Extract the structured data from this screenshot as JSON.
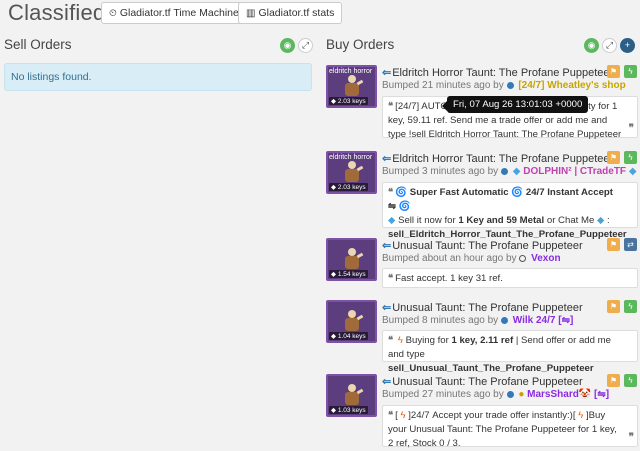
{
  "header": {
    "title": "Classifieds",
    "time_machine_label": "Gladiator.tf Time Machine",
    "stats_label": "Gladiator.tf stats"
  },
  "sell": {
    "title": "Sell Orders",
    "empty": "No listings found."
  },
  "buy": {
    "title": "Buy Orders",
    "listings": [
      {
        "thumb_name": "eldritch horror",
        "price": "2.03 keys",
        "title": "Eldritch Horror Taunt: The Profane Puppeteer",
        "bumped": "Bumped 21 minutes ago by",
        "user": "[24/7] Wheatley's shop",
        "user_color": "#c9a400",
        "msg_a": "[24/7] AUTO",
        "msg_b": "ng this beauty for 1 key, 59.11 ref. Send me a trade offer or add me and type !sell Eldritch Horror Taunt: The Profane Puppeteer",
        "action2": "lightning"
      },
      {
        "thumb_name": "eldritch horror",
        "price": "2.03 keys",
        "title": "Eldritch Horror Taunt: The Profane Puppeteer",
        "bumped": "Bumped 3 minutes ago by",
        "user": "DOLPHIN² | CTradeTF",
        "user_color": "#c040b0",
        "msg_a": "Super Fast Automatic",
        "msg_b": "24/7 Instant Accept ⇋",
        "msg_c": "Sell it now for",
        "msg_d": "1 Key and 59 Metal",
        "msg_e": "or Chat Me",
        "msg_f": "sell_Eldritch_Horror_Taunt_The_Profane_Puppeteer",
        "action2": "lightning"
      },
      {
        "price": "1.54 keys",
        "title": "Unusual Taunt: The Profane Puppeteer",
        "bumped": "Bumped about an hour ago by",
        "user": "Vexon",
        "user_color": "#8a2be2",
        "msg_a": "Fast accept. 1 key 31 ref.",
        "action2": "swap"
      },
      {
        "price": "1.04 keys",
        "title": "Unusual Taunt: The Profane Puppeteer",
        "bumped": "Bumped 8 minutes ago by",
        "user": "Wilk 24/7 [⇋]",
        "user_color": "#8a2be2",
        "msg_a": "Buying for",
        "msg_b": "1 key, 2.11 ref",
        "msg_c": "| Send offer or add me and type",
        "msg_d": "sell_Unusual_Taunt_The_Profane_Puppeteer",
        "action2": "lightning"
      },
      {
        "price": "1.03 keys",
        "title": "Unusual Taunt: The Profane Puppeteer",
        "bumped": "Bumped 27 minutes ago by",
        "user": "MarsShard🤡 [⇋]",
        "user_color": "#8a2be2",
        "msg_a": "[",
        "msg_b": "]24/7 Accept your trade offer instantly:)[",
        "msg_c": "]Buy your Unusual Taunt: The Profane Puppeteer for 1 key, 2 ref, Stock 0 / 3.",
        "action2": "lightning"
      }
    ]
  },
  "tooltip": "Fri, 07 Aug 26 13:01:03 +0000"
}
